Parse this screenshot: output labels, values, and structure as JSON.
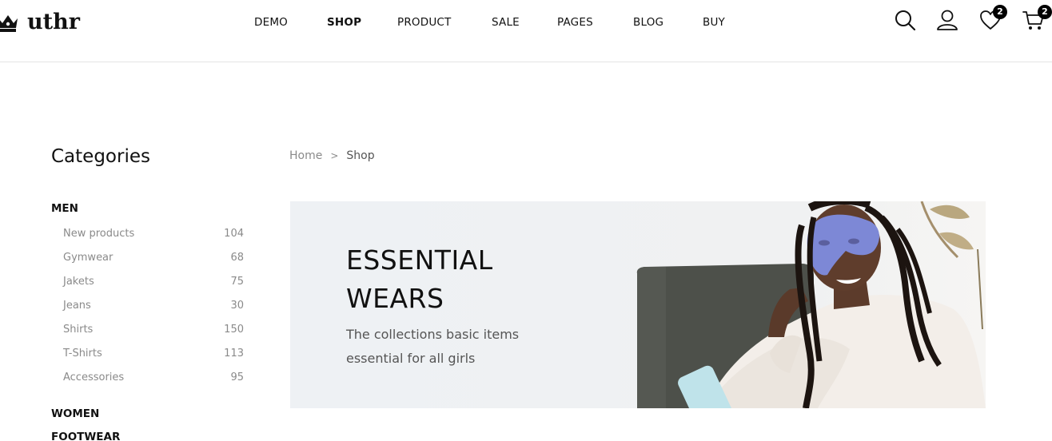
{
  "header": {
    "logo_text": "uthr",
    "nav": [
      {
        "label": "DEMO",
        "active": false
      },
      {
        "label": "SHOP",
        "active": true
      },
      {
        "label": "PRODUCT",
        "active": false
      },
      {
        "label": "SALE",
        "active": false
      },
      {
        "label": "PAGES",
        "active": false
      },
      {
        "label": "BLOG",
        "active": false
      },
      {
        "label": "BUY",
        "active": false
      }
    ],
    "icons": {
      "search": "search-icon",
      "account": "user-icon",
      "wishlist": "heart-icon",
      "cart": "cart-icon"
    },
    "wishlist_count": "2",
    "cart_count": "2"
  },
  "sidebar": {
    "title": "Categories",
    "groups": [
      {
        "label": "MEN",
        "items": [
          {
            "name": "New products",
            "count": "104"
          },
          {
            "name": "Gymwear",
            "count": "68"
          },
          {
            "name": "Jakets",
            "count": "75"
          },
          {
            "name": "Jeans",
            "count": "30"
          },
          {
            "name": "Shirts",
            "count": "150"
          },
          {
            "name": "T-Shirts",
            "count": "113"
          },
          {
            "name": "Accessories",
            "count": "95"
          }
        ]
      },
      {
        "label": "WOMEN",
        "items": []
      },
      {
        "label": "FOOTWEAR",
        "items": []
      }
    ]
  },
  "breadcrumb": {
    "home": "Home",
    "separator": ">",
    "current": "Shop"
  },
  "banner": {
    "title_line1": "ESSENTIAL",
    "title_line2": "WEARS",
    "subtitle_line1": "The collections basic items",
    "subtitle_line2": "essential for all girls"
  },
  "colors": {
    "text": "#111111",
    "muted": "#8a8a8a",
    "badge": "#000000",
    "banner_bg": "#eef1f4",
    "sofa": "#4d504a",
    "mask": "#7d88d6",
    "robe": "#f3eee9"
  }
}
